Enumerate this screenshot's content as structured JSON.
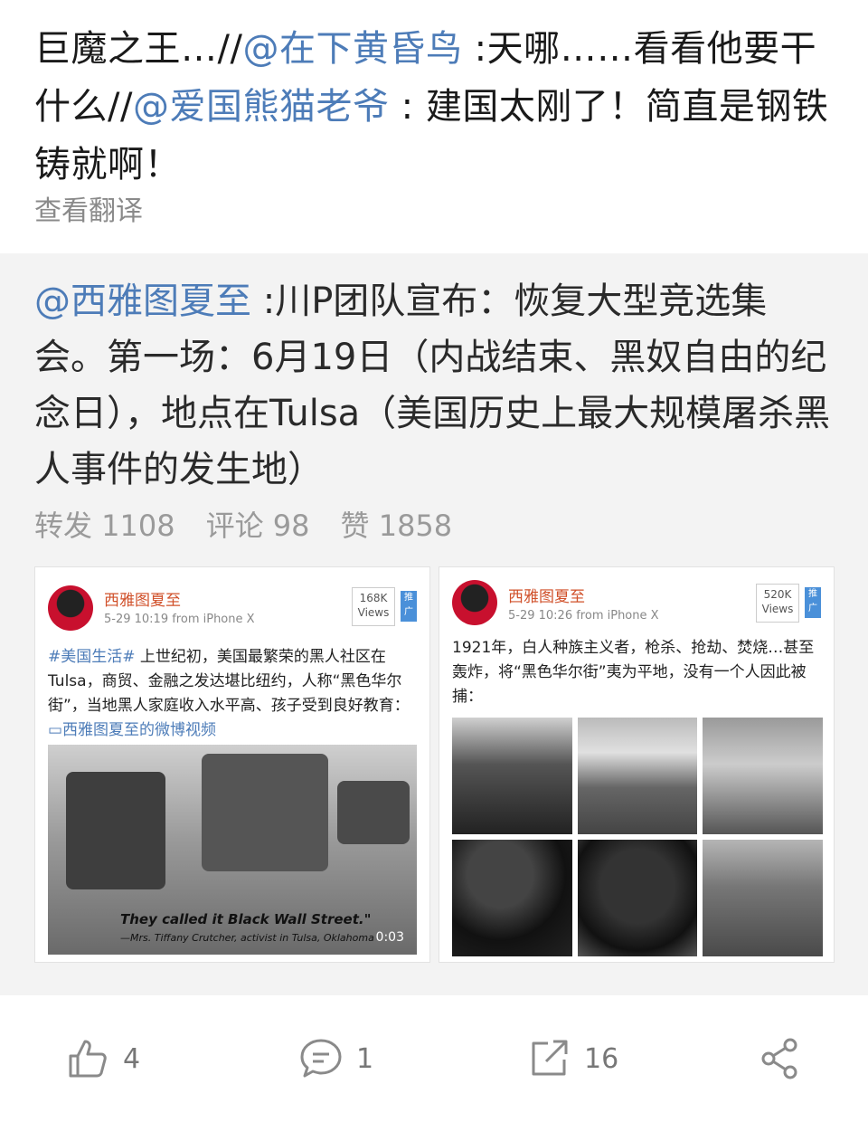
{
  "post": {
    "segments": [
      {
        "text": "巨魔之王…//",
        "mention": false
      },
      {
        "text": "@在下黄昏鸟",
        "mention": true
      },
      {
        "text": " :天哪……看看他要干什么//",
        "mention": false
      },
      {
        "text": "@爱国熊猫老爷",
        "mention": true
      },
      {
        "text": " : 建国太刚了！简直是钢铁铸就啊！",
        "mention": false
      }
    ],
    "translate_label": "查看翻译"
  },
  "repost": {
    "mention": "@西雅图夏至",
    "text": " :川P团队宣布：恢复大型竞选集会。第一场：6月19日（内战结束、黑奴自由的纪念日），地点在Tulsa（美国历史上最大规模屠杀黑人事件的发生地）",
    "stats": {
      "forward": "转发 1108",
      "comment": "评论 98",
      "like": "赞 1858"
    },
    "thumbs": [
      {
        "name": "西雅图夏至",
        "meta": "5-29 10:19  from iPhone X",
        "views_num": "168K",
        "views_label": "Views",
        "tag": "推广",
        "hashtag": "#美国生活#",
        "body": " 上世纪初，美国最繁荣的黑人社区在Tulsa，商贸、金融之发达堪比纽约，人称“黑色华尔街”，当地黑人家庭收入水平高、孩子受到良好教育：",
        "link": "▭西雅图夏至的微博视频",
        "video_caption": "They called it Black Wall Street.\"",
        "video_sub": "—Mrs. Tiffany Crutcher, activist in Tulsa, Oklahoma",
        "video_time": "0:03"
      },
      {
        "name": "西雅图夏至",
        "meta": "5-29 10:26  from iPhone X",
        "views_num": "520K",
        "views_label": "Views",
        "tag": "推广",
        "body": "1921年，白人种族主义者，枪杀、抢劫、焚烧…甚至轰炸，将“黑色华尔街”夷为平地，没有一个人因此被捕："
      }
    ]
  },
  "actions": {
    "like_count": "4",
    "comment_count": "1",
    "share_count": "16"
  },
  "colors": {
    "mention": "#4d7cb8",
    "repost_bg": "#f3f3f3",
    "muted": "#9a9a9a"
  }
}
